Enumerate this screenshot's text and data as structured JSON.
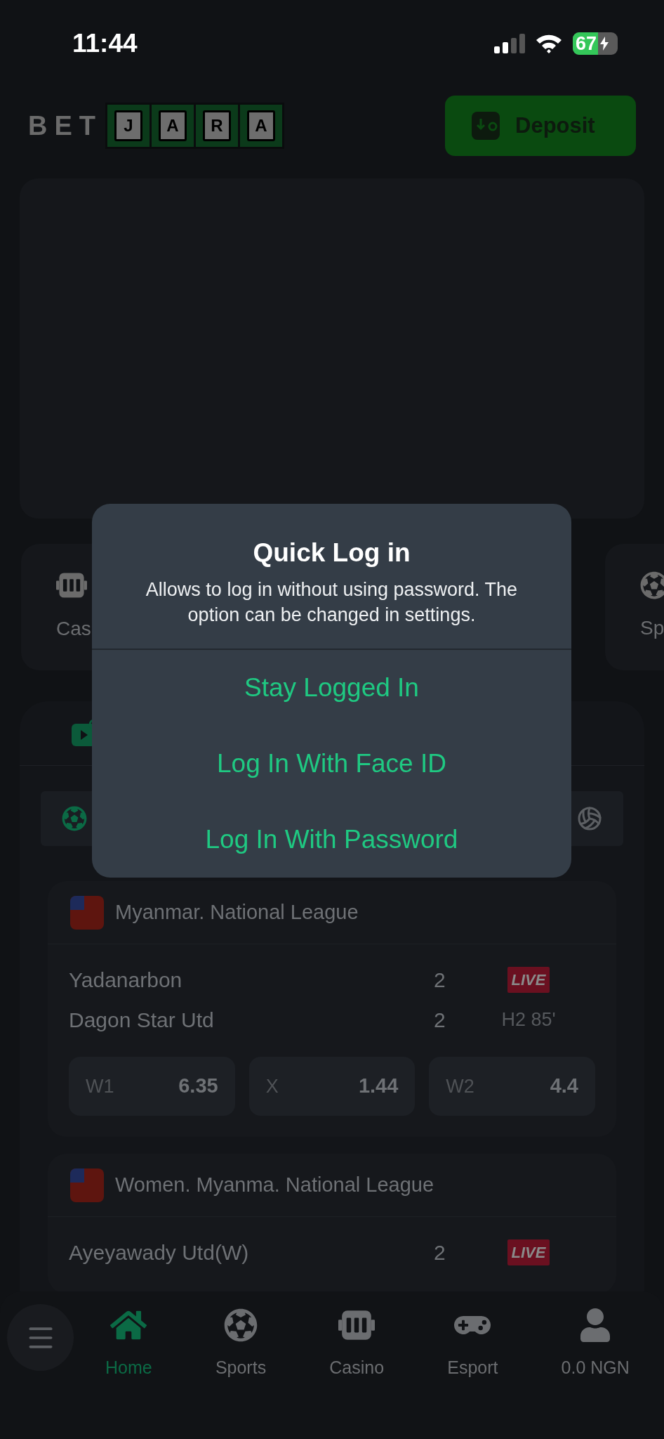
{
  "status_bar": {
    "time": "11:44",
    "battery": "67"
  },
  "header": {
    "logo_prefix": "BET",
    "logo_letters": [
      "J",
      "A",
      "R",
      "A"
    ],
    "deposit_button": "Deposit"
  },
  "categories": [
    {
      "kind": "casino",
      "label": "Cas"
    },
    {
      "kind": "sports",
      "label": "Sp"
    }
  ],
  "live_section": {
    "sport_tabs": [
      {
        "kind": "soccer",
        "selected": true
      },
      {
        "kind": "volleyball",
        "selected": false
      }
    ]
  },
  "matches": [
    {
      "league": "Myanmar. National League",
      "teams": [
        {
          "name": "Yadanarbon",
          "score": "2"
        },
        {
          "name": "Dagon Star Utd",
          "score": "2"
        }
      ],
      "badge": "LIVE",
      "time": "H2 85'",
      "odds": [
        {
          "label": "W1",
          "value": "6.35"
        },
        {
          "label": "X",
          "value": "1.44"
        },
        {
          "label": "W2",
          "value": "4.4"
        }
      ]
    },
    {
      "league": "Women. Myanma. National League",
      "teams": [
        {
          "name": "Ayeyawady Utd(W)",
          "score": "2"
        }
      ],
      "badge": "LIVE"
    }
  ],
  "dialog": {
    "title": "Quick Log in",
    "message": "Allows to log in without using password. The option can be changed in settings.",
    "options": [
      "Stay Logged In",
      "Log In With Face ID",
      "Log In With Password"
    ]
  },
  "bottom_nav": {
    "items": [
      {
        "kind": "home",
        "label": "Home",
        "selected": true
      },
      {
        "kind": "sports",
        "label": "Sports",
        "selected": false
      },
      {
        "kind": "casino",
        "label": "Casino",
        "selected": false
      },
      {
        "kind": "esport",
        "label": "Esport",
        "selected": false
      },
      {
        "kind": "account",
        "label": "0.0 NGN",
        "selected": false
      }
    ]
  }
}
